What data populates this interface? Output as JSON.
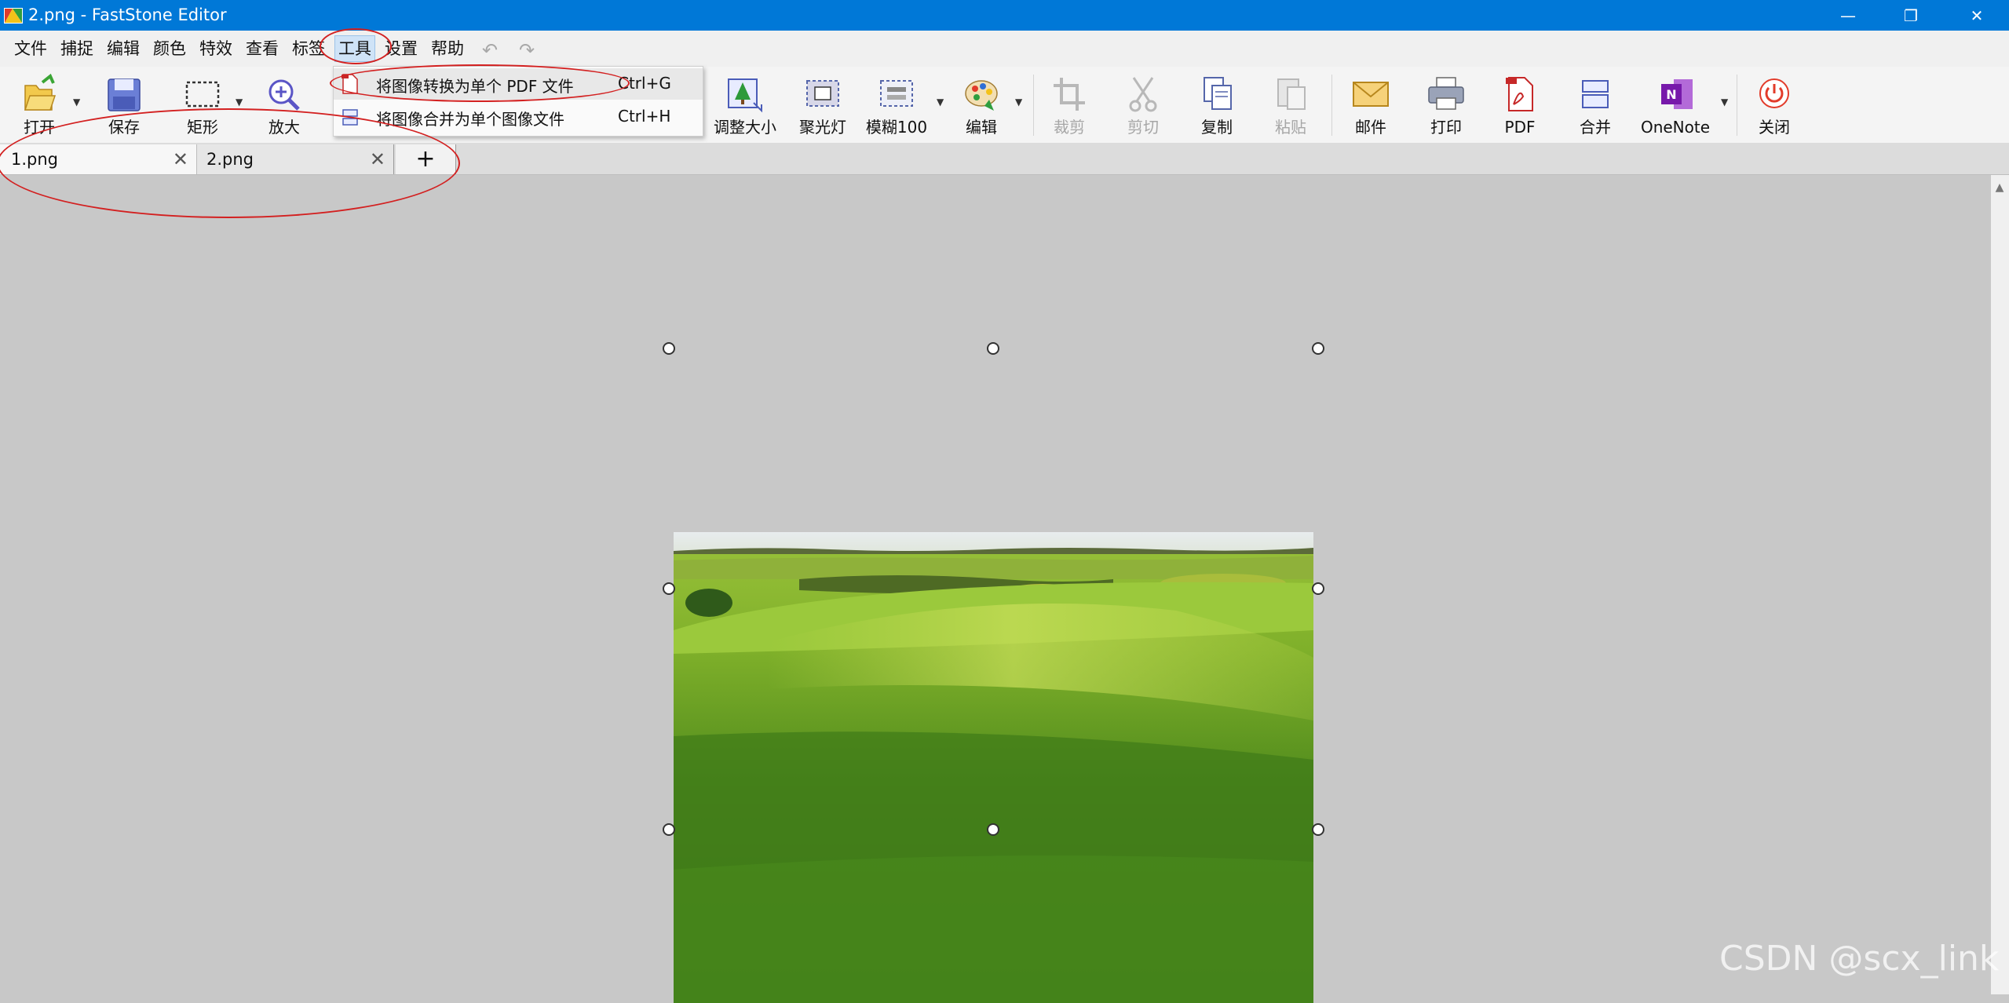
{
  "window": {
    "title": "2.png - FastStone Editor",
    "controls": {
      "minimize": "—",
      "restore": "❐",
      "close": "✕"
    }
  },
  "menu": {
    "items": [
      "文件",
      "捕捉",
      "编辑",
      "颜色",
      "特效",
      "查看",
      "标签",
      "工具",
      "设置",
      "帮助"
    ],
    "active": "工具",
    "undo": "↶",
    "redo": "↷"
  },
  "toolbar": {
    "tools": [
      {
        "label": "打开",
        "icon": "open-folder-icon",
        "enabled": true
      },
      {
        "label": "保存",
        "icon": "save-disk-icon",
        "enabled": true
      },
      {
        "label": "矩形",
        "icon": "rectangle-select-icon",
        "enabled": true
      },
      {
        "label": "放大",
        "icon": "zoom-in-icon",
        "enabled": true
      },
      {
        "label": "调整大小",
        "icon": "resize-icon",
        "enabled": true
      },
      {
        "label": "聚光灯",
        "icon": "spotlight-icon",
        "enabled": true
      },
      {
        "label": "模糊100",
        "icon": "blur-icon",
        "enabled": true
      },
      {
        "label": "编辑",
        "icon": "paint-palette-icon",
        "enabled": true
      },
      {
        "label": "裁剪",
        "icon": "crop-icon",
        "enabled": false
      },
      {
        "label": "剪切",
        "icon": "scissors-icon",
        "enabled": false
      },
      {
        "label": "复制",
        "icon": "copy-icon",
        "enabled": true
      },
      {
        "label": "粘贴",
        "icon": "paste-icon",
        "enabled": false
      },
      {
        "label": "邮件",
        "icon": "mail-icon",
        "enabled": true
      },
      {
        "label": "打印",
        "icon": "printer-icon",
        "enabled": true
      },
      {
        "label": "PDF",
        "icon": "pdf-icon",
        "enabled": true
      },
      {
        "label": "合并",
        "icon": "merge-icon",
        "enabled": true
      },
      {
        "label": "OneNote",
        "icon": "onenote-icon",
        "enabled": true
      },
      {
        "label": "关闭",
        "icon": "power-icon",
        "enabled": true
      }
    ]
  },
  "tabs": {
    "items": [
      {
        "label": "1.png",
        "close": "✕"
      },
      {
        "label": "2.png",
        "close": "✕"
      }
    ],
    "add": "+"
  },
  "dropdown": {
    "items": [
      {
        "label": "将图像转换为单个 PDF 文件",
        "shortcut": "Ctrl+G"
      },
      {
        "label": "将图像合并为单个图像文件",
        "shortcut": "Ctrl+H"
      }
    ]
  },
  "canvas": {
    "image_subject": "green-meadow-landscape"
  },
  "colors": {
    "titlebar": "#0078d7",
    "annotation": "#d32020",
    "canvas": "#c8c8c8"
  },
  "watermark": "CSDN @scx_link"
}
